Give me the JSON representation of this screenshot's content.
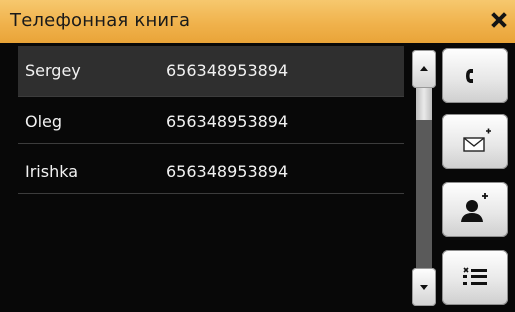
{
  "window": {
    "title": "Телефонная книга"
  },
  "contacts": [
    {
      "name": "Sergey",
      "number": "656348953894"
    },
    {
      "name": "Oleg",
      "number": "656348953894"
    },
    {
      "name": "Irishka",
      "number": "656348953894"
    }
  ],
  "selected_index": 0,
  "scrollbar": {
    "up_icon": "triangle-up-icon",
    "down_icon": "triangle-down-icon"
  },
  "actions": [
    {
      "id": "call",
      "icon": "phone-icon"
    },
    {
      "id": "message",
      "icon": "new-message-icon"
    },
    {
      "id": "add-contact",
      "icon": "add-contact-icon"
    },
    {
      "id": "delete-list",
      "icon": "delete-list-icon"
    }
  ],
  "colors": {
    "titlebar": "#f0b24c",
    "background": "#080808",
    "selected_row": "#2f2f2f"
  }
}
